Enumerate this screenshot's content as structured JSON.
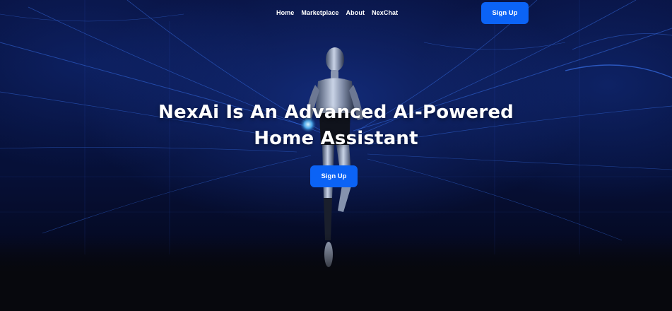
{
  "nav": {
    "links": [
      {
        "label": "Home"
      },
      {
        "label": "Marketplace"
      },
      {
        "label": "About"
      },
      {
        "label": "NexChat"
      }
    ],
    "signup_label": "Sign Up"
  },
  "hero": {
    "title_line1": "NexAi Is An Advanced AI-Powered",
    "title_line2": "Home Assistant",
    "cta_label": "Sign Up"
  },
  "colors": {
    "accent": "#0b63f6",
    "background_dark": "#07080d",
    "background_blue": "#081240"
  }
}
